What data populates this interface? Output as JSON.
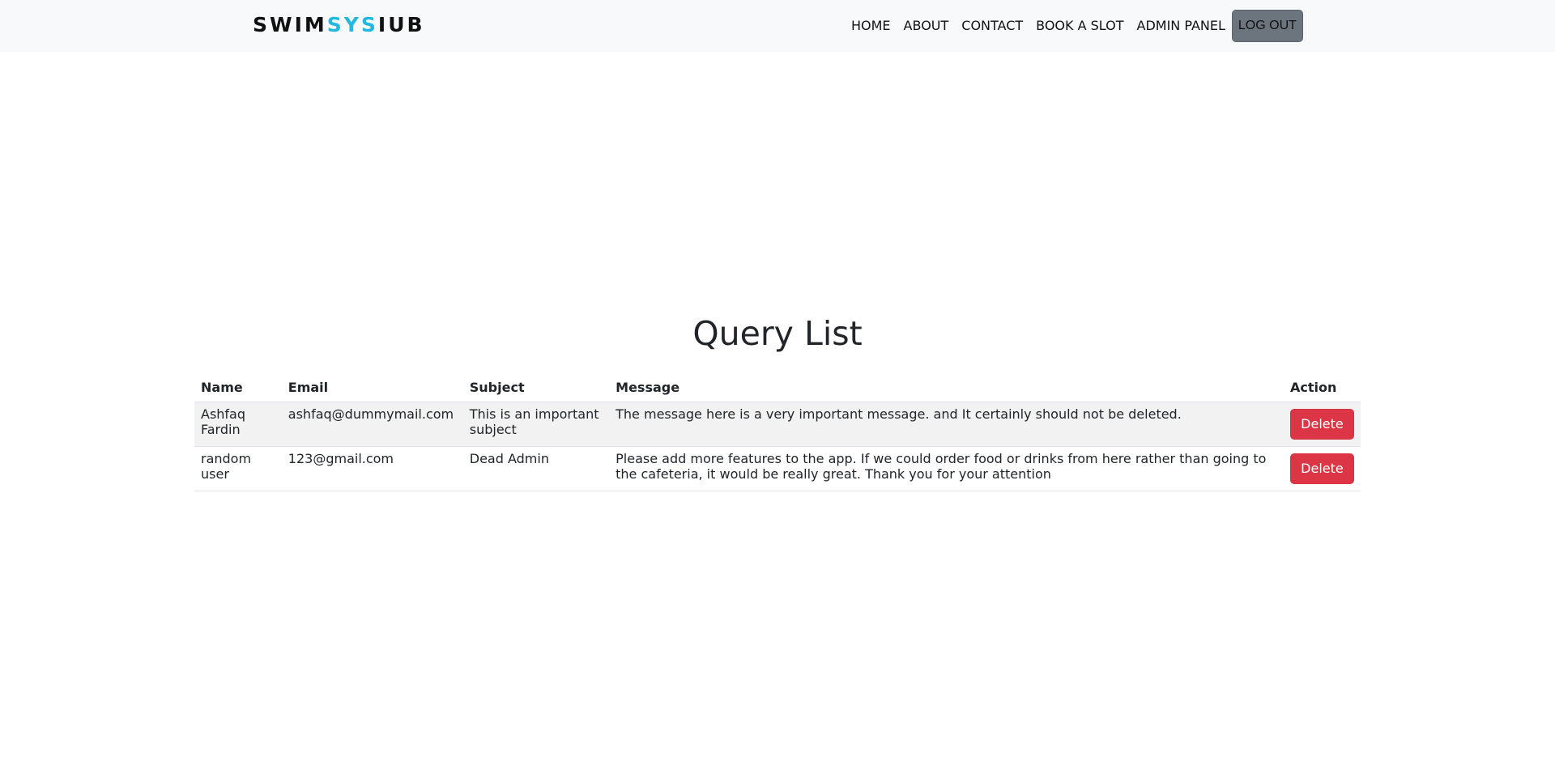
{
  "brand": {
    "part1": "SWIM",
    "part2": "SYS",
    "part3": "IUB",
    "accent_color": "#22b8e0"
  },
  "nav": {
    "items": [
      "HOME",
      "ABOUT",
      "CONTACT",
      "BOOK A SLOT",
      "ADMIN PANEL"
    ],
    "logout_label": "LOG OUT"
  },
  "page": {
    "title": "Query List"
  },
  "table": {
    "headers": [
      "Name",
      "Email",
      "Subject",
      "Message",
      "Action"
    ],
    "rows": [
      {
        "name": "Ashfaq Fardin",
        "email": "ashfaq@dummymail.com",
        "subject": "This is an important subject",
        "message": "The message here is a very important message. and It certainly should not be deleted.",
        "action": "Delete"
      },
      {
        "name": "random user",
        "email": "123@gmail.com",
        "subject": "Dead Admin",
        "message": "Please add more features to the app. If we could order food or drinks from here rather than going to the cafeteria, it would be really great. Thank you for your attention",
        "action": "Delete"
      }
    ]
  },
  "colors": {
    "delete_button": "#dc3545",
    "logout_button": "#6c757d",
    "navbar_bg": "#f8f9fa"
  }
}
